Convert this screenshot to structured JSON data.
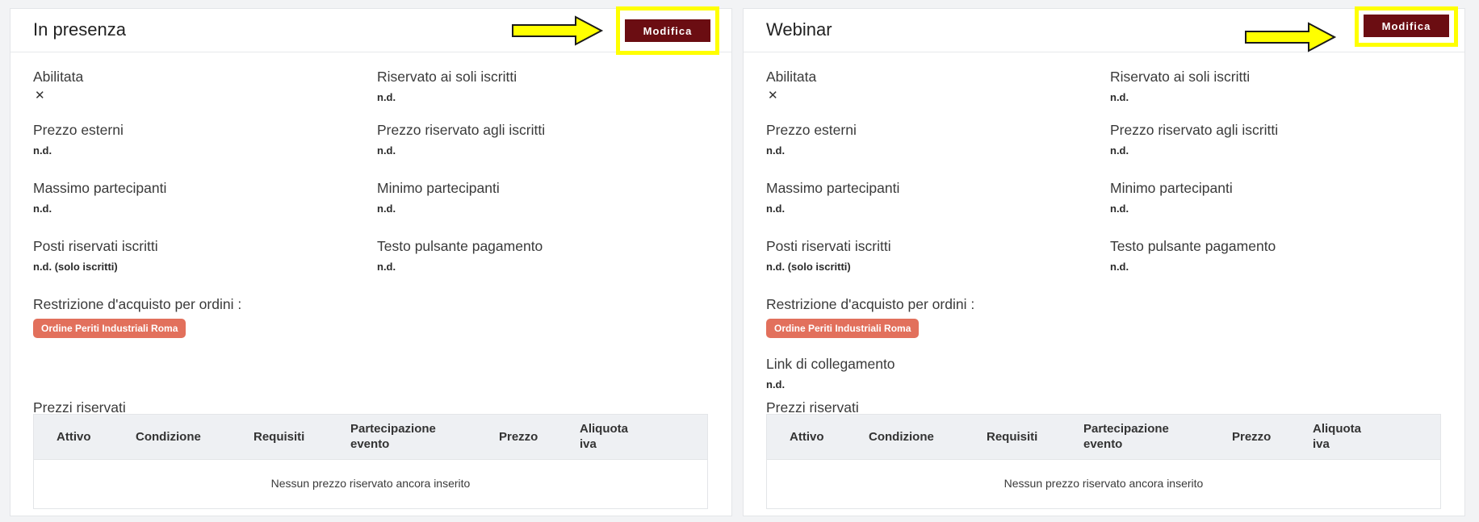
{
  "panels": [
    {
      "title": "In presenza",
      "edit_label": "Modifica",
      "fields": {
        "enabled_label": "Abilitata",
        "enabled_icon": "close-icon",
        "members_only_label": "Riservato ai soli iscritti",
        "members_only_value": "n.d.",
        "external_price_label": "Prezzo esterni",
        "external_price_value": "n.d.",
        "member_price_label": "Prezzo riservato agli iscritti",
        "member_price_value": "n.d.",
        "max_participants_label": "Massimo partecipanti",
        "max_participants_value": "n.d.",
        "min_participants_label": "Minimo partecipanti",
        "min_participants_value": "n.d.",
        "reserved_seats_label": "Posti riservati iscritti",
        "reserved_seats_value": "n.d. (solo iscritti)",
        "payment_button_label": "Testo pulsante pagamento",
        "payment_button_value": "n.d.",
        "purchase_restriction_label": "Restrizione d'acquisto per ordini :",
        "purchase_restriction_tag": "Ordine Periti Industriali Roma"
      },
      "reserved_prices": {
        "title": "Prezzi riservati",
        "columns": [
          "Attivo",
          "Condizione",
          "Requisiti",
          "Partecipazione evento",
          "Prezzo",
          "Aliquota iva"
        ],
        "empty_message": "Nessun prezzo riservato ancora inserito"
      }
    },
    {
      "title": "Webinar",
      "edit_label": "Modifica",
      "fields": {
        "enabled_label": "Abilitata",
        "enabled_icon": "close-icon",
        "members_only_label": "Riservato ai soli iscritti",
        "members_only_value": "n.d.",
        "external_price_label": "Prezzo esterni",
        "external_price_value": "n.d.",
        "member_price_label": "Prezzo riservato agli iscritti",
        "member_price_value": "n.d.",
        "max_participants_label": "Massimo partecipanti",
        "max_participants_value": "n.d.",
        "min_participants_label": "Minimo partecipanti",
        "min_participants_value": "n.d.",
        "reserved_seats_label": "Posti riservati iscritti",
        "reserved_seats_value": "n.d. (solo iscritti)",
        "payment_button_label": "Testo pulsante pagamento",
        "payment_button_value": "n.d.",
        "purchase_restriction_label": "Restrizione d'acquisto per ordini :",
        "purchase_restriction_tag": "Ordine Periti Industriali Roma",
        "connection_link_label": "Link di collegamento",
        "connection_link_value": "n.d."
      },
      "reserved_prices": {
        "title": "Prezzi riservati",
        "columns": [
          "Attivo",
          "Condizione",
          "Requisiti",
          "Partecipazione evento",
          "Prezzo",
          "Aliquota iva"
        ],
        "empty_message": "Nessun prezzo riservato ancora inserito"
      }
    }
  ],
  "annotation": {
    "arrow_color": "#ffff00",
    "highlight_color": "#ffff00",
    "button_color": "#6b0d12",
    "tag_color": "#e2705c"
  }
}
